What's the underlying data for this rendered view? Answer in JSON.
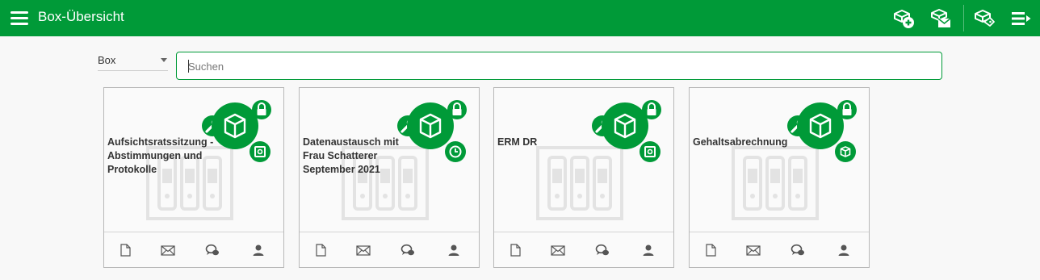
{
  "header": {
    "title": "Box-Übersicht",
    "icons": [
      "menu-icon",
      "box-add-icon",
      "box-mail-icon",
      "box-tag-icon",
      "list-menu-icon"
    ],
    "background": "#009a38"
  },
  "filter": {
    "selected": "Box"
  },
  "search": {
    "placeholder": "Suchen",
    "value": ""
  },
  "accent": "#009a38",
  "cards": [
    {
      "name": "Aufsichtsratssitzung - Abstimmungen und Protokolle",
      "status_icons": [
        "wrench-icon",
        "box-icon",
        "lock-icon",
        "safe-icon"
      ]
    },
    {
      "name": "Datenaustausch mit Frau Schatterer September 2021",
      "status_icons": [
        "wrench-icon",
        "box-icon",
        "lock-icon",
        "clock-icon"
      ]
    },
    {
      "name": "ERM DR",
      "status_icons": [
        "wrench-icon",
        "box-icon",
        "lock-icon",
        "safe-icon"
      ]
    },
    {
      "name": "Gehaltsabrechnung",
      "status_icons": [
        "wrench-icon",
        "box-icon",
        "lock-icon",
        "small-box-icon"
      ]
    }
  ],
  "card_actions": [
    "document-icon",
    "mail-icon",
    "chat-icon",
    "user-icon"
  ]
}
